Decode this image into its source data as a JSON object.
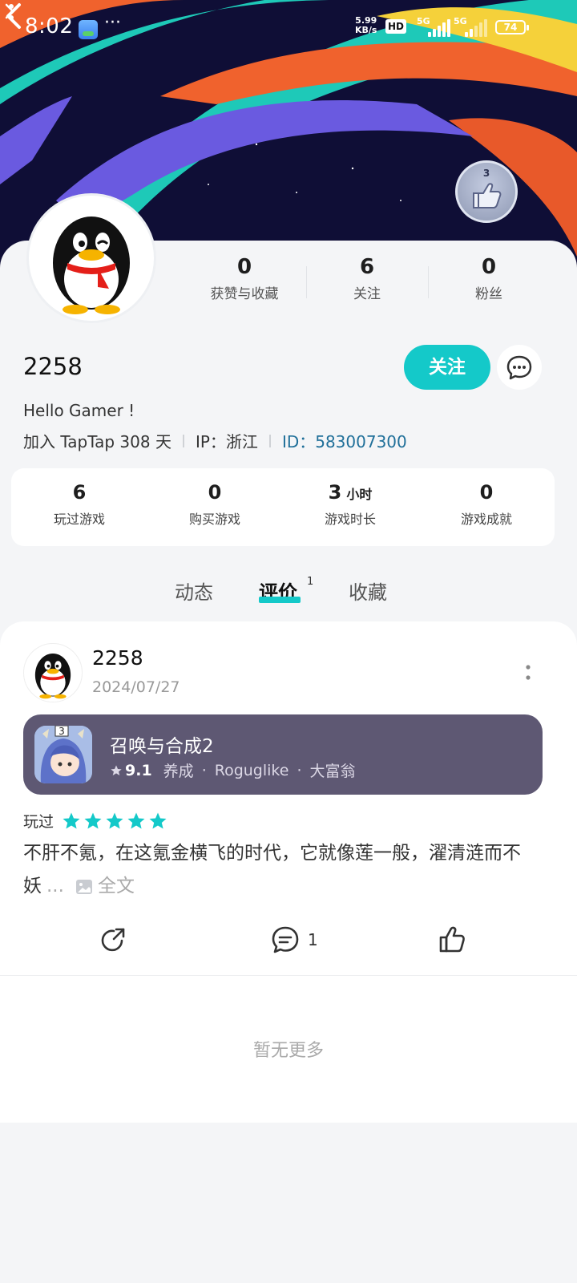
{
  "status_bar": {
    "time": "8:02",
    "net_speed_value": "5.99",
    "net_speed_unit": "KB/s",
    "hd_badge": "HD",
    "signal1_label": "5G",
    "signal2_label": "5G",
    "battery": "74"
  },
  "badge": {
    "level": "3"
  },
  "profile": {
    "username": "2258",
    "bio": "Hello Gamer !",
    "joined": "加入 TapTap 308 天",
    "ip": "IP：浙江",
    "id": "ID：583007300",
    "follow_label": "关注"
  },
  "social_stats": [
    {
      "value": "0",
      "label": "获赞与收藏"
    },
    {
      "value": "6",
      "label": "关注"
    },
    {
      "value": "0",
      "label": "粉丝"
    }
  ],
  "game_stats": [
    {
      "value": "6",
      "unit": "",
      "label": "玩过游戏"
    },
    {
      "value": "0",
      "unit": "",
      "label": "购买游戏"
    },
    {
      "value": "3",
      "unit": "小时",
      "label": "游戏时长"
    },
    {
      "value": "0",
      "unit": "",
      "label": "游戏成就"
    }
  ],
  "tabs": [
    {
      "label": "动态"
    },
    {
      "label": "评价",
      "count": "1",
      "active": true
    },
    {
      "label": "收藏"
    }
  ],
  "review": {
    "author": "2258",
    "date": "2024/07/27",
    "game": {
      "title": "召唤与合成2",
      "score": "9.1",
      "tags": [
        "养成",
        "Roguglike",
        "大富翁"
      ],
      "icon_number": "3"
    },
    "played_label": "玩过",
    "rating": 5,
    "text": "不肝不氪，在这氪金横飞的时代，它就像莲一般，濯清涟而不妖",
    "ellipsis": "...",
    "full_text_label": "全文",
    "comment_count": "1"
  },
  "footer": {
    "no_more": "暂无更多"
  },
  "colors": {
    "accent": "#14c9c9",
    "game_card_bg": "#5e5873",
    "id_link": "#1f6f99",
    "hero_bg": "#0f0e36"
  }
}
